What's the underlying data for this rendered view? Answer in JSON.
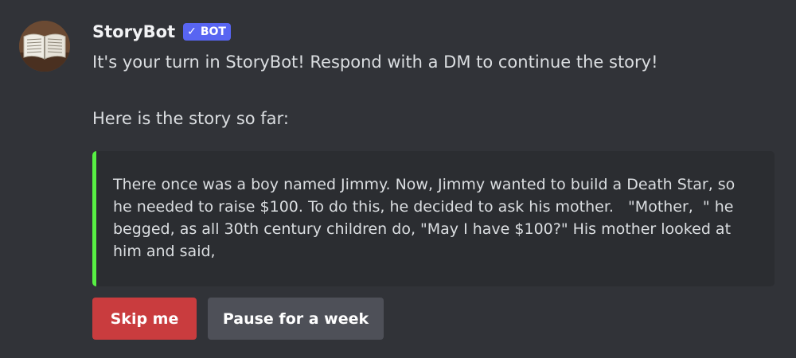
{
  "message": {
    "author": {
      "username": "StoryBot",
      "bot_tag": "BOT",
      "bot_tag_check": "✓",
      "avatar_icon": "open-book-icon"
    },
    "lines": [
      "It's your turn in StoryBot! Respond with a DM to continue the story!",
      "Here is the story so far:"
    ],
    "quote": {
      "text": "There once was a boy named Jimmy. Now, Jimmy wanted to build a Death Star, so he needed to raise $100. To do this, he decided to ask his mother.   \"Mother,  \" he begged, as all 30th century children do, \"May I have $100?\" His mother looked at him and said,",
      "bar_color": "#57f043"
    },
    "buttons": {
      "skip_label": "Skip me",
      "pause_label": "Pause for a week"
    }
  },
  "colors": {
    "background": "#313338",
    "quote_background": "#2b2d31",
    "bot_tag": "#5865f2",
    "danger_button": "#c93c3e",
    "secondary_button": "#4e5058"
  }
}
